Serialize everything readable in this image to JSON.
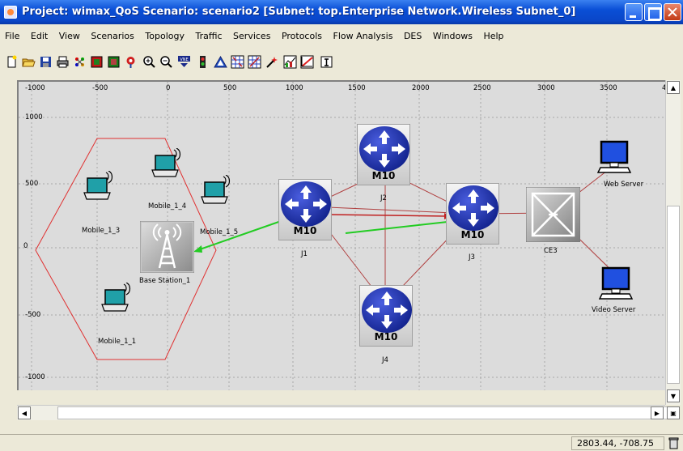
{
  "window": {
    "title": "Project: wimax_QoS Scenario: scenario2  [Subnet: top.Enterprise Network.Wireless Subnet_0]"
  },
  "menu": [
    "File",
    "Edit",
    "View",
    "Scenarios",
    "Topology",
    "Traffic",
    "Services",
    "Protocols",
    "Flow Analysis",
    "DES",
    "Windows",
    "Help"
  ],
  "toolbar_icons": [
    "new-icon",
    "open-icon",
    "save-icon",
    "print-icon",
    "object-palette-icon",
    "failure-icon",
    "recover-icon",
    "marker-icon",
    "zoom-in-icon",
    "zoom-out-icon",
    "vne-icon",
    "config-run-icon",
    "triangle-icon",
    "stats-grid-icon",
    "results-icon",
    "wand-icon",
    "graph-icon",
    "graph-red-icon",
    "text-icon"
  ],
  "ruler": {
    "x_ticks": [
      "-1000",
      "-500",
      "0",
      "500",
      "1000",
      "1500",
      "2000",
      "2500",
      "3000",
      "3500",
      "4"
    ],
    "y_ticks": [
      "1000",
      "500",
      "0",
      "-500",
      "-1000"
    ]
  },
  "nodes": {
    "mobile_1_3": "Mobile_1_3",
    "mobile_1_4": "Mobile_1_4",
    "mobile_1_5": "Mobile_1_5",
    "mobile_1_1": "Mobile_1_1",
    "base_station": "Base Station_1",
    "j1": "J1",
    "j2": "J2",
    "j3": "J3",
    "j4": "J4",
    "ce3": "CE3",
    "web_server": "Web Server",
    "video_server": "Video Server",
    "router_model": "M10"
  },
  "status": {
    "coordinates": "2803.44, -708.75"
  },
  "colors": {
    "titlebar": "#0a4fd6",
    "canvas": "#dcdcdc",
    "link": "#c04040",
    "flow": "#22cc22",
    "router": "#1a2a9a"
  }
}
